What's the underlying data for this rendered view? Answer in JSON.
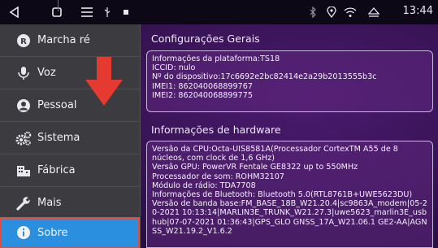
{
  "status_bar": {
    "time": "13:44",
    "icons": [
      "back-icon",
      "home-icon",
      "menu-icon",
      "usb-icon",
      "square-icon",
      "bluetooth-icon",
      "location-icon",
      "wifi-icon",
      "eject-icon"
    ]
  },
  "sidebar": {
    "items": [
      {
        "label": "Marcha ré",
        "icon": "reverse-icon"
      },
      {
        "label": "Voz",
        "icon": "microphone-icon"
      },
      {
        "label": "Pessoal",
        "icon": "person-icon"
      },
      {
        "label": "Sistema",
        "icon": "gears-icon"
      },
      {
        "label": "Fábrica",
        "icon": "factory-icon"
      },
      {
        "label": "Mais",
        "icon": "wrench-icon"
      },
      {
        "label": "Sobre",
        "icon": "info-icon"
      }
    ],
    "active": "Sobre"
  },
  "general": {
    "title": "Configurações Gerais",
    "lines": [
      "Informações da plataforma:TS18",
      "ICCID: nulo",
      "Nº do dispositivo:17c6692e2bc82414e2a29b2013555b3c",
      "IMEI1: 862040068899767",
      "IMEI2: 862040068899775"
    ]
  },
  "hardware": {
    "title": "Informações de hardware",
    "lines": [
      "Versão da CPU:Octa-UIS8581A(Processador CortexTM A55 de 8 núcleos, com clock de 1,6 GHz)",
      "Versão GPU: PowerVR Fentale GE8322 up to 550MHz",
      "Processador de som: ROHM32107",
      "Módulo de rádio: TDA7708",
      "Informações de Bluetooth: Bluetooth 5.0(RTL8761B+UWE5623DU)",
      "Versão de banda base:FM_BASE_18B_W21.20.4|sc9863A_modem|05-20-2021 10:13:14|MARLIN3E_TRUNK_W21.27.3|uwe5623_marlin3E_usbhub|07-07-2021 01:36:43|GPS_GLO GNSS_17A_W21.06.1 GE2-AA|AGNSS_W21.19.2_V1.6.2"
    ]
  },
  "colors": {
    "active_item": "#2b8fe0",
    "highlight_border": "#e64b3c",
    "arrow": "#e53a2f"
  }
}
